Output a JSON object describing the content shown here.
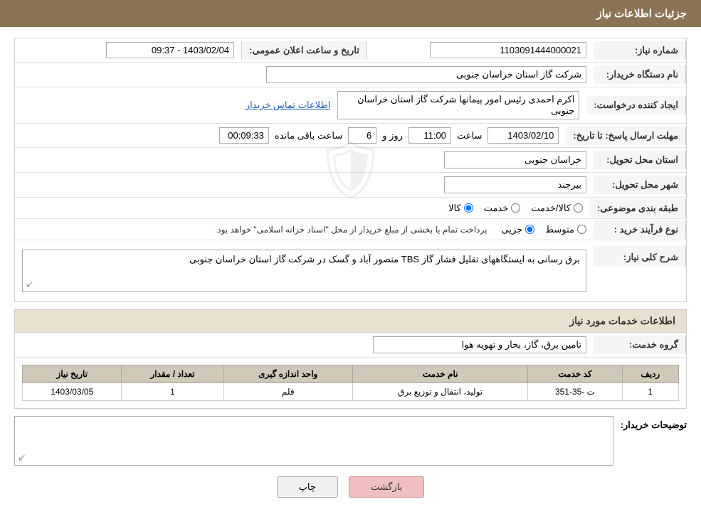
{
  "header": {
    "title": "جزئیات اطلاعات نیاز"
  },
  "fields": {
    "need_number_label": "شماره نیاز:",
    "need_number_value": "1103091444000021",
    "buyer_org_label": "نام دستگاه خریدار:",
    "buyer_org_value": "شرکت گاز استان خراسان جنوبی",
    "requester_label": "ایجاد کننده درخواست:",
    "requester_value": "اکرم احمدی رئیس امور پیمانها شرکت گاز استان خراسان جنوبی",
    "requester_link": "اطلاعات تماس خریدار",
    "announce_date_label": "تاریخ و ساعت اعلان عمومی:",
    "announce_date_value": "1403/02/04 - 09:37",
    "reply_deadline_label": "مهلت ارسال پاسخ: تا تاریخ:",
    "reply_date": "1403/02/10",
    "reply_time_label": "ساعت",
    "reply_time": "11:00",
    "reply_days_label": "روز و",
    "reply_days": "6",
    "reply_remaining_label": "ساعت باقی مانده",
    "reply_remaining": "00:09:33",
    "province_label": "استان محل تحویل:",
    "province_value": "خراسان جنوبی",
    "city_label": "شهر محل تحویل:",
    "city_value": "بیرجند",
    "category_label": "طبقه بندی موضوعی:",
    "category_kala": "کالا",
    "category_khedmat": "خدمت",
    "category_kala_khedmat": "کالا/خدمت",
    "process_label": "نوع فرآیند خرید :",
    "process_jozvi": "جزیی",
    "process_motavaset": "متوسط",
    "process_note": "پرداخت تمام یا بخشی از مبلغ خریدار از محل \"اسناد خزانه اسلامی\" خواهد بود.",
    "description_label": "شرح کلی نیاز:",
    "description_value": "برق رسانی به ایستگاههای تقلیل فشار گاز TBS منصور آباد و گسک در شرکت گاز استان خراسان جنوبی"
  },
  "services_section": {
    "title": "اطلاعات خدمات مورد نیاز",
    "service_group_label": "گروه خدمت:",
    "service_group_value": "تامین برق، گاز، بخار و تهویه هوا",
    "table": {
      "headers": [
        "ردیف",
        "کد خدمت",
        "نام خدمت",
        "واحد اندازه گیری",
        "تعداد / مقدار",
        "تاریخ نیاز"
      ],
      "rows": [
        {
          "row": "1",
          "code": "ت -35-351",
          "name": "تولید، انتقال و توزیع برق",
          "unit": "قلم",
          "quantity": "1",
          "date": "1403/03/05"
        }
      ]
    }
  },
  "buyer_notes": {
    "label": "توضیحات خریدار:",
    "value": ""
  },
  "buttons": {
    "print": "چاپ",
    "back": "بازگشت"
  }
}
